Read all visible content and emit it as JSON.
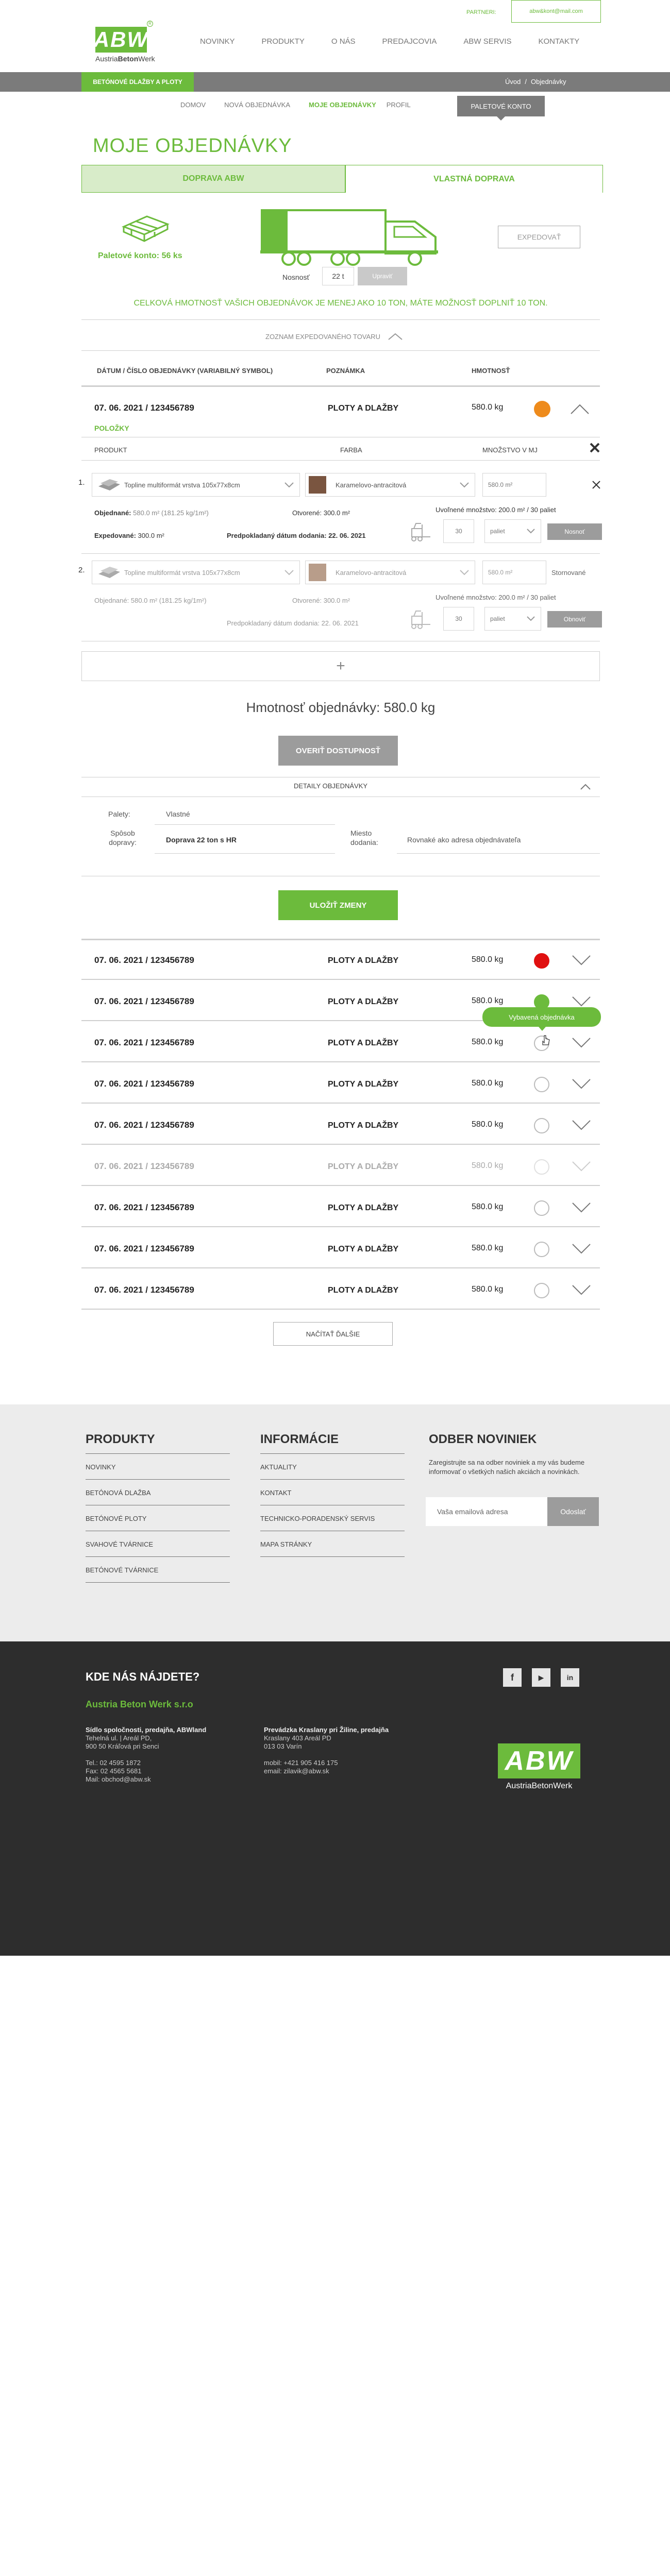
{
  "header": {
    "partner_label": "PARTNERI:",
    "email": "abw&kont@mail.com",
    "logo_text": "ABW",
    "logo_sub1": "Austria",
    "logo_sub2": "Beton",
    "logo_sub3": "Werk",
    "nav": [
      "NOVINKY",
      "PRODUKTY",
      "O NÁS",
      "PREDAJCOVIA",
      "ABW SERVIS",
      "KONTAKTY"
    ]
  },
  "breadcrumb_bar": {
    "tag": "BETÓNOVÉ DLAŽBY A PLOTY",
    "crumb_home": "Úvod",
    "sep": "/",
    "crumb_current": "Objednávky"
  },
  "subnav": {
    "items": [
      "DOMOV",
      "NOVÁ OBJEDNÁVKA",
      "MOJE OBJEDNÁVKY",
      "PROFIL"
    ],
    "active_button": "PALETOVÉ KONTO"
  },
  "page_title": "MOJE OBJEDNÁVKY",
  "tabs": {
    "left": "DOPRAVA ABW",
    "right": "VLASTNÁ DOPRAVA"
  },
  "transport": {
    "pallet_account": "Paletové konto: 56 ks",
    "capacity_label": "Nosnosť",
    "capacity_value": "22 t",
    "edit_button": "Upraviť",
    "dispatch_button": "EXPEDOVAŤ",
    "notice": "CELKOVÁ HMOTNOSŤ VAŠICH OBJEDNÁVOK JE MENEJ AKO 10 TON, MÁTE MOŽNOSŤ DOPLNIŤ 10 TON.",
    "dispatched_toggle": "ZOZNAM EXPEDOVANÉHO TOVARU"
  },
  "table_headers": {
    "date": "DÁTUM / ČÍSLO OBJEDNÁVKY (VARIABILNÝ SYMBOL)",
    "note": "POZNÁMKA",
    "weight": "HMOTNOSŤ"
  },
  "open_order": {
    "date": "07. 06. 2021 / 123456789",
    "category": "PLOTY A DLAŽBY",
    "weight": "580.0 kg",
    "items_label": "POLOŽKY",
    "col_product": "PRODUKT",
    "col_color": "FARBA",
    "col_qty": "MNOŽSTVO V MJ",
    "items": [
      {
        "num": "1.",
        "product": "Topline multiformát vrstva 105x77x8cm",
        "color": "Karamelovo-antracitová",
        "swatch": "#7a5540",
        "qty": "580.0 m²",
        "ordered_label": "Objednané:",
        "ordered": "580.0 m² (181.25 kg/1m²)",
        "opened_label": "Otvorené:",
        "opened": "300.0 m²",
        "released": "Uvoľnené množstvo: 200.0 m² / 30 paliet",
        "shipped_label": "Expedované:",
        "shipped": "300.0 m²",
        "eta": "Predpokladaný dátum dodania: 22. 06. 2021",
        "pallets": "30",
        "unit": "paliet",
        "action": "Nosnoť"
      },
      {
        "num": "2.",
        "product": "Topline multiformát vrstva 105x77x8cm",
        "color": "Karamelovo-antracitová",
        "swatch": "#b89d8a",
        "qty": "580.0 m²",
        "status": "Stornované",
        "ordered_label": "Objednané:",
        "ordered": "580.0 m² (181.25 kg/1m²)",
        "opened_label": "Otvorené:",
        "opened": "300.0 m²",
        "released": "Uvoľnené množstvo: 200.0 m² / 30 paliet",
        "eta": "Predpokladaný dátum dodania: 22. 06. 2021",
        "pallets": "30",
        "unit": "paliet",
        "action": "Obnoviť"
      }
    ],
    "add_symbol": "+",
    "total": "Hmotnosť objednávky: 580.0 kg",
    "verify_button": "OVERIŤ DOSTUPNOSŤ",
    "details_toggle": "DETAILY OBJEDNÁVKY",
    "details": {
      "pallets_label": "Palety:",
      "pallets_value": "Vlastné",
      "transport_label": "Spôsob dopravy:",
      "transport_value": "Doprava 22 ton s HR",
      "place_label": "Miesto dodania:",
      "place_value": "Rovnaké ako adresa objednávateľa"
    },
    "save_button": "ULOŽIŤ ZMENY"
  },
  "orders": [
    {
      "date": "07. 06. 2021 / 123456789",
      "category": "PLOTY A DLAŽBY",
      "weight": "580.0 kg",
      "status": "red"
    },
    {
      "date": "07. 06. 2021 / 123456789",
      "category": "PLOTY A DLAŽBY",
      "weight": "580.0 kg",
      "status": "green"
    },
    {
      "date": "07. 06. 2021 / 123456789",
      "category": "PLOTY A DLAŽBY",
      "weight": "580.0 kg",
      "status": "empty"
    },
    {
      "date": "07. 06. 2021 / 123456789",
      "category": "PLOTY A DLAŽBY",
      "weight": "580.0 kg",
      "status": "empty"
    },
    {
      "date": "07. 06. 2021 / 123456789",
      "category": "PLOTY A DLAŽBY",
      "weight": "580.0 kg",
      "status": "empty"
    },
    {
      "date": "07. 06. 2021 / 123456789",
      "category": "PLOTY A DLAŽBY",
      "weight": "580.0 kg",
      "status": "muted"
    },
    {
      "date": "07. 06. 2021 / 123456789",
      "category": "PLOTY A DLAŽBY",
      "weight": "580.0 kg",
      "status": "empty"
    },
    {
      "date": "07. 06. 2021 / 123456789",
      "category": "PLOTY A DLAŽBY",
      "weight": "580.0 kg",
      "status": "empty"
    },
    {
      "date": "07. 06. 2021 / 123456789",
      "category": "PLOTY A DLAŽBY",
      "weight": "580.0 kg",
      "status": "empty"
    }
  ],
  "tooltip": "Vybavená objednávka",
  "load_more": "NAČÍTAŤ ĎALŠIE",
  "footer": {
    "products_title": "PRODUKTY",
    "products": [
      "NOVINKY",
      "BETÓNOVÁ DLAŽBA",
      "BETÓNOVÉ PLOTY",
      "SVAHOVÉ TVÁRNICE",
      "BETÓNOVÉ TVÁRNICE"
    ],
    "info_title": "INFORMÁCIE",
    "info": [
      "AKTUALITY",
      "KONTAKT",
      "TECHNICKO-PORADENSKÝ SERVIS",
      "MAPA STRÁNKY"
    ],
    "newsletter_title": "ODBER NOVINIEK",
    "newsletter_text": "Zaregistrujte sa na odber noviniek a my vás budeme informovať o všetkých našich akciách a novinkách.",
    "newsletter_placeholder": "Vaša emailová adresa",
    "newsletter_button": "Odoslať"
  },
  "contact": {
    "title": "KDE NÁS NÁJDETE?",
    "company": "Austria Beton Werk s.r.o",
    "hq": [
      "Sídlo spoločnosti, predajňa, ABWland",
      "Tehelná ul. | Areál PD,",
      "900 50 Kráľová pri Senci",
      "",
      "Tel.: 02 4595 1872",
      "Fax: 02 4565 5681",
      "Mail: obchod@abw.sk"
    ],
    "branch": [
      "Prevádzka Kraslany pri Žiline, predajňa",
      "Kraslany 403 Areál PD",
      "013 03 Varín",
      "",
      "mobil: +421 905 416 175",
      "email: zilavik@abw.sk"
    ],
    "social": [
      "f",
      "▶",
      "in"
    ],
    "logo": "ABW",
    "logo_sub": "AustriaBetonWerk"
  },
  "colors": {
    "green": "#6cbb3c",
    "orange": "#ee8b1c",
    "red": "#e01010",
    "dark": "#333333",
    "grey": "#7b7b7b"
  }
}
